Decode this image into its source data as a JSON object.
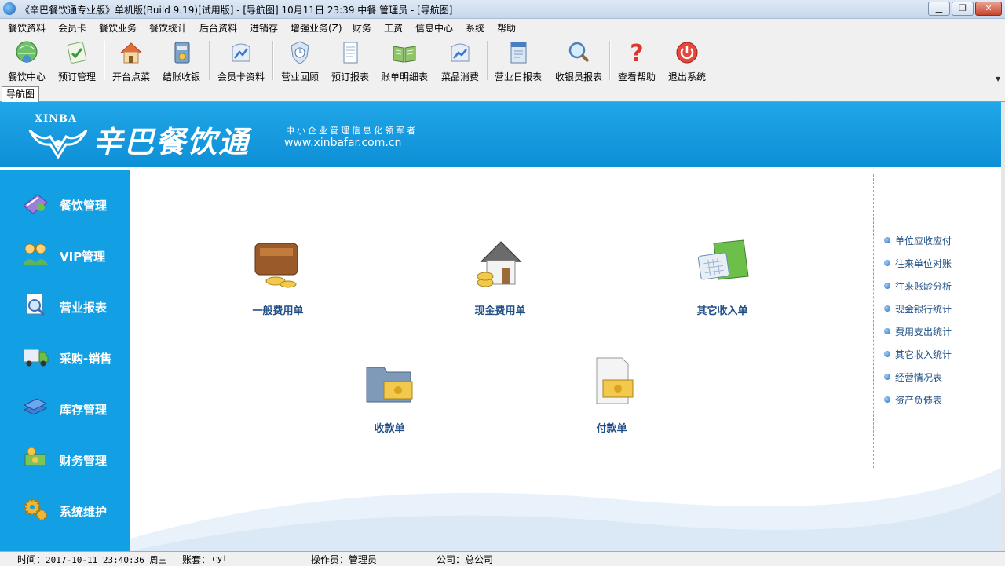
{
  "window": {
    "title": "《辛巴餐饮通专业版》单机版(Build 9.19)[试用版] - [导航图]  10月11日 23:39 中餐 管理员 - [导航图]",
    "minimize_icon": "minimize-icon",
    "maximize_icon": "restore-icon",
    "close_icon": "close-icon"
  },
  "menu": [
    "餐饮资料",
    "会员卡",
    "餐饮业务",
    "餐饮统计",
    "后台资料",
    "进销存",
    "增强业务(Z)",
    "财务",
    "工资",
    "信息中心",
    "系统",
    "帮助"
  ],
  "toolbar": [
    {
      "label": "餐饮中心",
      "icon": "globe-person-icon"
    },
    {
      "label": "预订管理",
      "icon": "note-check-icon"
    },
    {
      "label": "开台点菜",
      "icon": "house-icon"
    },
    {
      "label": "结账收银",
      "icon": "cash-book-icon"
    },
    {
      "label": "会员卡资料",
      "icon": "card-chart-icon"
    },
    {
      "label": "营业回顾",
      "icon": "shield-clock-icon"
    },
    {
      "label": "预订报表",
      "icon": "document-icon"
    },
    {
      "label": "账单明细表",
      "icon": "open-book-icon"
    },
    {
      "label": "菜品消费",
      "icon": "chart-doc-icon"
    },
    {
      "label": "营业日报表",
      "icon": "calendar-doc-icon"
    },
    {
      "label": "收银员报表",
      "icon": "magnifier-icon"
    },
    {
      "label": "查看帮助",
      "icon": "question-icon"
    },
    {
      "label": "退出系统",
      "icon": "power-icon"
    }
  ],
  "tab": {
    "label": "导航图"
  },
  "banner": {
    "logo_word": "XINBA",
    "brand_name": "辛巴餐饮通",
    "slogan": "中小企业管理信息化领军者",
    "url": "www.xinbafar.com.cn"
  },
  "left_nav": [
    {
      "label": "餐饮管理",
      "icon": "dining-icon"
    },
    {
      "label": "VIP管理",
      "icon": "people-icon"
    },
    {
      "label": "营业报表",
      "icon": "report-search-icon"
    },
    {
      "label": "采购-销售",
      "icon": "truck-icon"
    },
    {
      "label": "库存管理",
      "icon": "stack-books-icon"
    },
    {
      "label": "财务管理",
      "icon": "money-icon"
    },
    {
      "label": "系统维护",
      "icon": "gears-icon"
    }
  ],
  "functions": [
    {
      "label": "一般费用单",
      "icon": "wallet-coins-icon"
    },
    {
      "label": "现金费用单",
      "icon": "house-coins-icon"
    },
    {
      "label": "其它收入单",
      "icon": "calculator-folder-icon"
    },
    {
      "label": "收款单",
      "icon": "folder-cash-icon"
    },
    {
      "label": "付款单",
      "icon": "document-cash-icon"
    }
  ],
  "links": [
    "单位应收应付",
    "往来单位对账",
    "往来账龄分析",
    "现金银行统计",
    "费用支出统计",
    "其它收入统计",
    "经营情况表",
    "资产负债表"
  ],
  "status": {
    "time_label": "时间：",
    "time_value": "2017-10-11 23:40:36 周三",
    "account_label": "账套：",
    "account_value": "cyt",
    "operator_label": "操作员：",
    "operator_value": "管理员",
    "company_label": "公司：",
    "company_value": "总公司"
  },
  "colors": {
    "banner_blue": "#1aa3e6",
    "nav_blue": "#129fe3",
    "link_blue": "#1f4e86"
  }
}
